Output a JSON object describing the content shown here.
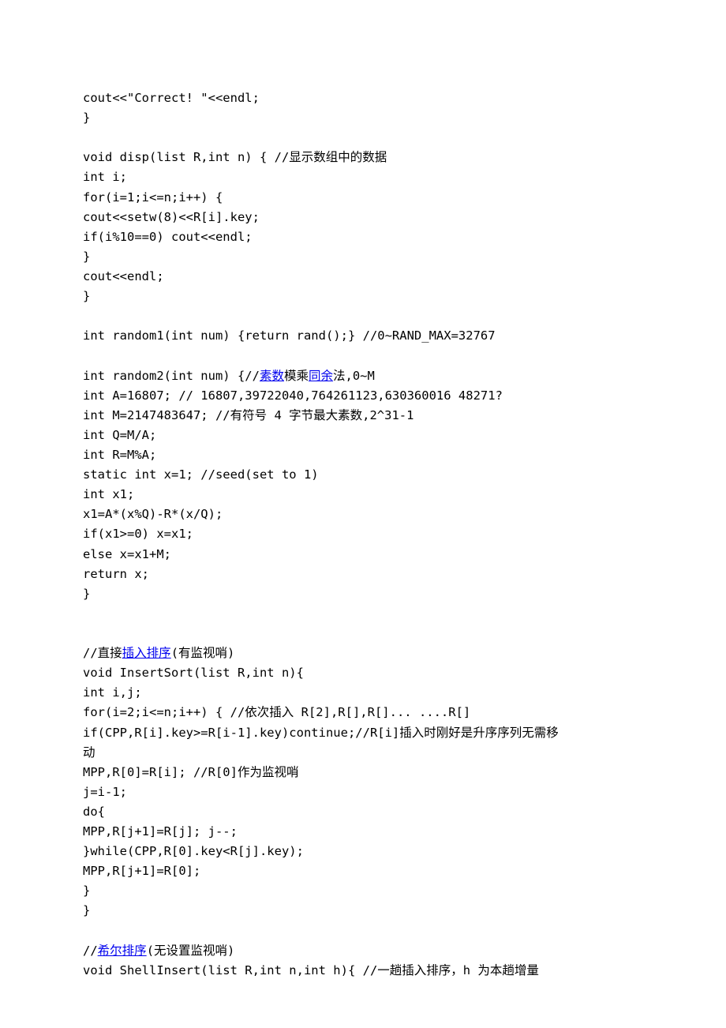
{
  "lines": [
    {
      "segments": [
        {
          "t": "cout<<\"Correct! \"<<endl;"
        }
      ]
    },
    {
      "segments": [
        {
          "t": "}"
        }
      ]
    },
    {
      "segments": [
        {
          "t": ""
        }
      ]
    },
    {
      "segments": [
        {
          "t": "void disp(list R,int n) { //显示数组中的数据"
        }
      ]
    },
    {
      "segments": [
        {
          "t": "int i;"
        }
      ]
    },
    {
      "segments": [
        {
          "t": "for(i=1;i<=n;i++) {"
        }
      ]
    },
    {
      "segments": [
        {
          "t": "cout<<setw(8)<<R[i].key;"
        }
      ]
    },
    {
      "segments": [
        {
          "t": "if(i%10==0) cout<<endl;"
        }
      ]
    },
    {
      "segments": [
        {
          "t": "}"
        }
      ]
    },
    {
      "segments": [
        {
          "t": "cout<<endl;"
        }
      ]
    },
    {
      "segments": [
        {
          "t": "}"
        }
      ]
    },
    {
      "segments": [
        {
          "t": ""
        }
      ]
    },
    {
      "segments": [
        {
          "t": "int random1(int num) {return rand();} //0~RAND_MAX=32767"
        }
      ]
    },
    {
      "segments": [
        {
          "t": ""
        }
      ]
    },
    {
      "segments": [
        {
          "t": "int random2(int num) {//"
        },
        {
          "t": "素数",
          "link": true
        },
        {
          "t": "模乘"
        },
        {
          "t": "同余",
          "link": true
        },
        {
          "t": "法,0~M"
        }
      ]
    },
    {
      "segments": [
        {
          "t": "int A=16807; // 16807,39722040,764261123,630360016 48271?"
        }
      ]
    },
    {
      "segments": [
        {
          "t": "int M=2147483647; //有符号 4 字节最大素数,2^31-1"
        }
      ]
    },
    {
      "segments": [
        {
          "t": "int Q=M/A;"
        }
      ]
    },
    {
      "segments": [
        {
          "t": "int R=M%A;"
        }
      ]
    },
    {
      "segments": [
        {
          "t": "static int x=1; //seed(set to 1)"
        }
      ]
    },
    {
      "segments": [
        {
          "t": "int x1;"
        }
      ]
    },
    {
      "segments": [
        {
          "t": "x1=A*(x%Q)-R*(x/Q);"
        }
      ]
    },
    {
      "segments": [
        {
          "t": "if(x1>=0) x=x1;"
        }
      ]
    },
    {
      "segments": [
        {
          "t": "else x=x1+M;"
        }
      ]
    },
    {
      "segments": [
        {
          "t": "return x;"
        }
      ]
    },
    {
      "segments": [
        {
          "t": "}"
        }
      ]
    },
    {
      "segments": [
        {
          "t": ""
        }
      ]
    },
    {
      "segments": [
        {
          "t": ""
        }
      ]
    },
    {
      "segments": [
        {
          "t": "//直接"
        },
        {
          "t": "插入排序",
          "link": true
        },
        {
          "t": "(有监视哨)"
        }
      ]
    },
    {
      "segments": [
        {
          "t": "void InsertSort(list R,int n){"
        }
      ]
    },
    {
      "segments": [
        {
          "t": "int i,j;"
        }
      ]
    },
    {
      "segments": [
        {
          "t": "for(i=2;i<=n;i++) { //依次插入 R[2],R[],R[]... ....R[]"
        }
      ]
    },
    {
      "segments": [
        {
          "t": "if(CPP,R[i].key>=R[i-1].key)continue;//R[i]插入时刚好是升序序列无需移"
        }
      ]
    },
    {
      "segments": [
        {
          "t": "动"
        }
      ]
    },
    {
      "segments": [
        {
          "t": "MPP,R[0]=R[i]; //R[0]作为监视哨"
        }
      ]
    },
    {
      "segments": [
        {
          "t": "j=i-1;"
        }
      ]
    },
    {
      "segments": [
        {
          "t": "do{"
        }
      ]
    },
    {
      "segments": [
        {
          "t": "MPP,R[j+1]=R[j]; j--;"
        }
      ]
    },
    {
      "segments": [
        {
          "t": "}while(CPP,R[0].key<R[j].key);"
        }
      ]
    },
    {
      "segments": [
        {
          "t": "MPP,R[j+1]=R[0];"
        }
      ]
    },
    {
      "segments": [
        {
          "t": "}"
        }
      ]
    },
    {
      "segments": [
        {
          "t": "}"
        }
      ]
    },
    {
      "segments": [
        {
          "t": ""
        }
      ]
    },
    {
      "segments": [
        {
          "t": "//"
        },
        {
          "t": "希尔排序",
          "link": true
        },
        {
          "t": "(无设置监视哨)"
        }
      ]
    },
    {
      "segments": [
        {
          "t": "void ShellInsert(list R,int n,int h){ //一趟插入排序，h 为本趟增量"
        }
      ]
    }
  ]
}
